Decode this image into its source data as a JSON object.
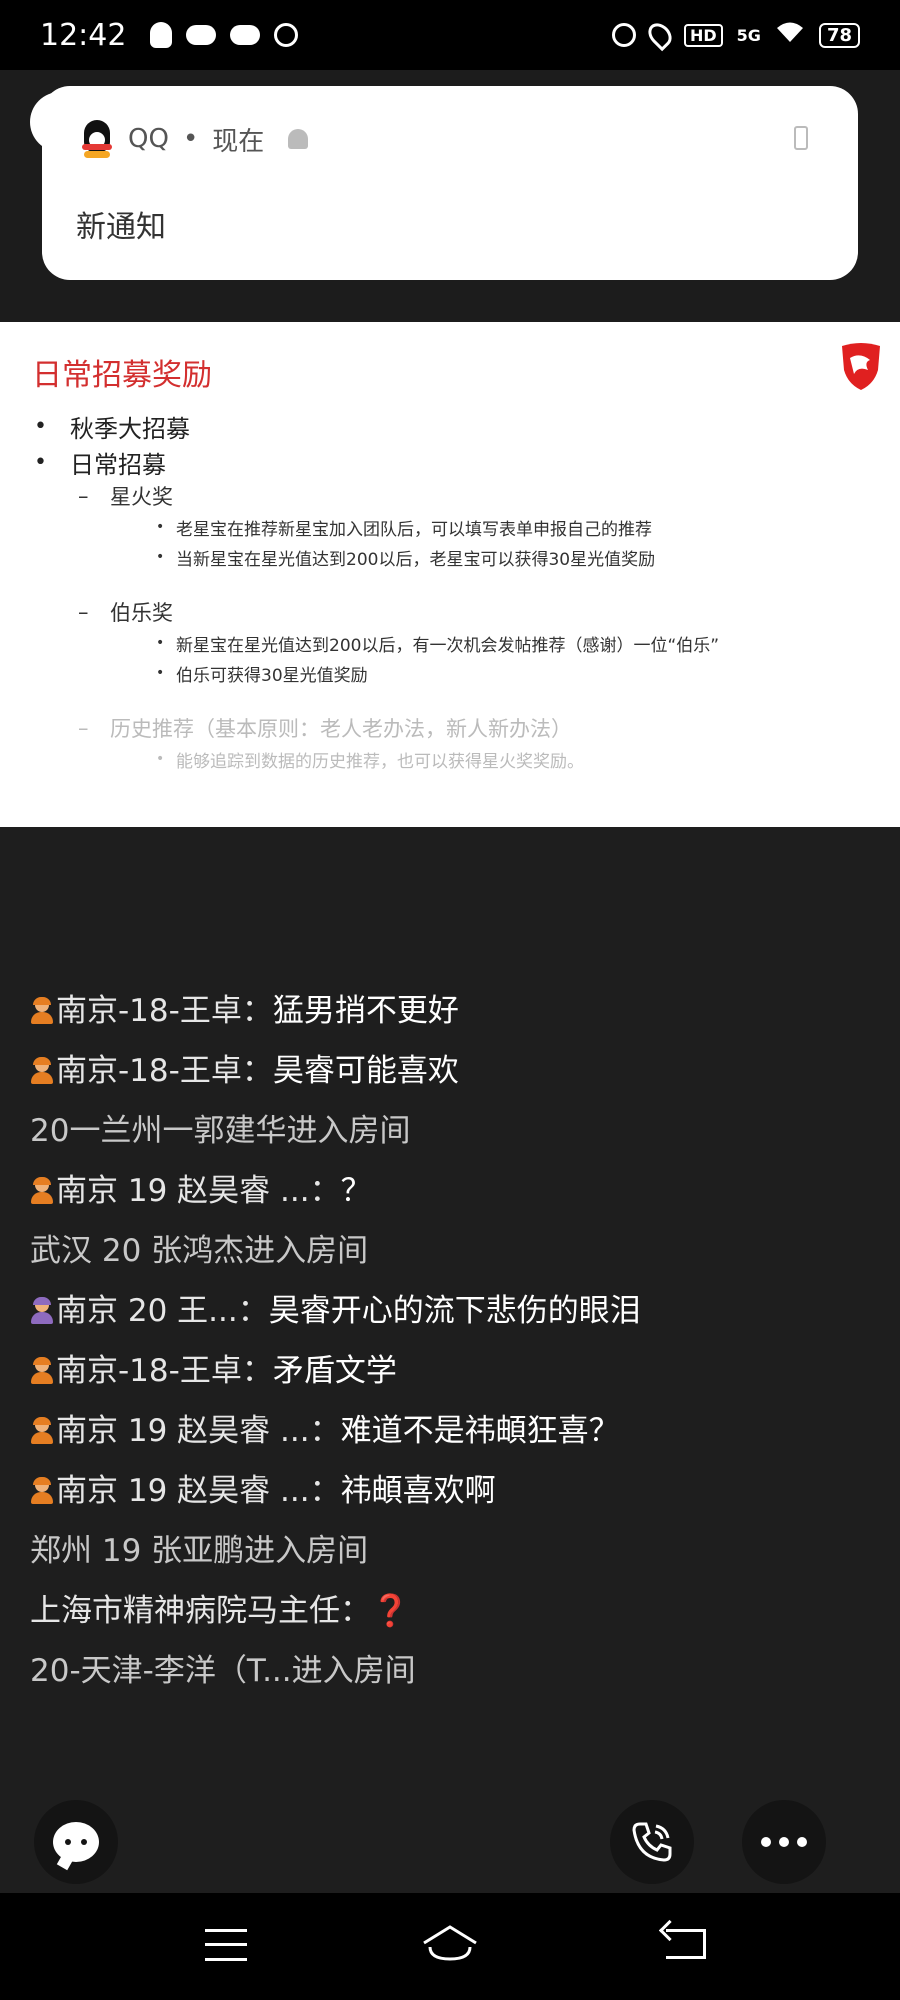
{
  "status_bar": {
    "time": "12:42",
    "left_icons": [
      "qq-penguin-icon",
      "cloud-icon",
      "cloud-icon",
      "alarm-icon"
    ],
    "hd_label": "HD",
    "signal_label": "5G",
    "battery": "78"
  },
  "notification": {
    "app_name": "QQ",
    "separator": "•",
    "time": "现在",
    "title": "新通知"
  },
  "slide": {
    "title": "日常招募奖励",
    "items": [
      {
        "level": 1,
        "text": "秋季大招募"
      },
      {
        "level": 1,
        "text": "日常招募"
      },
      {
        "level": 2,
        "text": "星火奖"
      },
      {
        "level": 3,
        "text": "老星宝在推荐新星宝加入团队后，可以填写表单申报自己的推荐"
      },
      {
        "level": 3,
        "text": "当新星宝在星光值达到200以后，老星宝可以获得30星光值奖励"
      },
      {
        "level": 2,
        "text": "伯乐奖"
      },
      {
        "level": 3,
        "text": "新星宝在星光值达到200以后，有一次机会发帖推荐（感谢）一位“伯乐”"
      },
      {
        "level": 3,
        "text": "伯乐可获得30星光值奖励"
      },
      {
        "level": 2,
        "text": "历史推荐（基本原则：老人老办法，新人新办法）"
      },
      {
        "level": 3,
        "text": "能够追踪到数据的历史推荐，也可以获得星火奖奖励。"
      }
    ]
  },
  "chat": {
    "messages": [
      {
        "sender": "南京-18-王卓",
        "text": "猛男捎不更好"
      },
      {
        "sender": "南京-18-王卓",
        "text": "昊睿可能喜欢"
      },
      {
        "system": "20一兰州一郭建华进入房间"
      },
      {
        "sender": "南京 19 赵昊睿 ...",
        "text": "？"
      },
      {
        "system": "武汉 20 张鸿杰进入房间"
      },
      {
        "sender": "南京  20   王...",
        "text": "昊睿开心的流下悲伤的眼泪"
      },
      {
        "sender": "南京-18-王卓",
        "text": "矛盾文学"
      },
      {
        "sender": "南京 19 赵昊睿 ...",
        "text": "难道不是祎頔狂喜？"
      },
      {
        "sender": "南京 19 赵昊睿 ...",
        "text": "祎頔喜欢啊"
      },
      {
        "system": "郑州 19 张亚鹏进入房间"
      },
      {
        "sender": "上海市精神病院马主任",
        "text": "❓"
      },
      {
        "system": "20-天津-李洋（T...进入房间"
      }
    ],
    "colon": "："
  }
}
